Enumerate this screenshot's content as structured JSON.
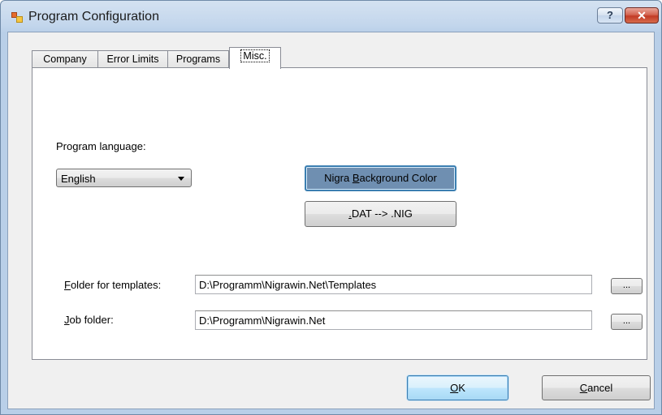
{
  "window": {
    "title": "Program Configuration",
    "help_label": "?",
    "close_label": "✕"
  },
  "tabs": [
    {
      "label": "Company"
    },
    {
      "label": "Error Limits"
    },
    {
      "label": "Programs"
    },
    {
      "label": "Misc."
    }
  ],
  "misc": {
    "language_label": "Program language:",
    "language_value": "English",
    "bg_color_pre": "Nigra ",
    "bg_color_key": "B",
    "bg_color_post": "ackground Color",
    "bg_color_swatch": "#6f8fb1",
    "dat_key": ".",
    "dat_post": "DAT --> .NIG",
    "templates_key": "F",
    "templates_post": "older for templates:",
    "templates_value": "D:\\Programm\\Nigrawin.Net\\Templates",
    "job_key": "J",
    "job_post": "ob folder:",
    "job_value": "D:\\Programm\\Nigrawin.Net",
    "browse_label": "..."
  },
  "footer": {
    "ok_key": "O",
    "ok_post": "K",
    "cancel_key": "C",
    "cancel_post": "ancel"
  }
}
